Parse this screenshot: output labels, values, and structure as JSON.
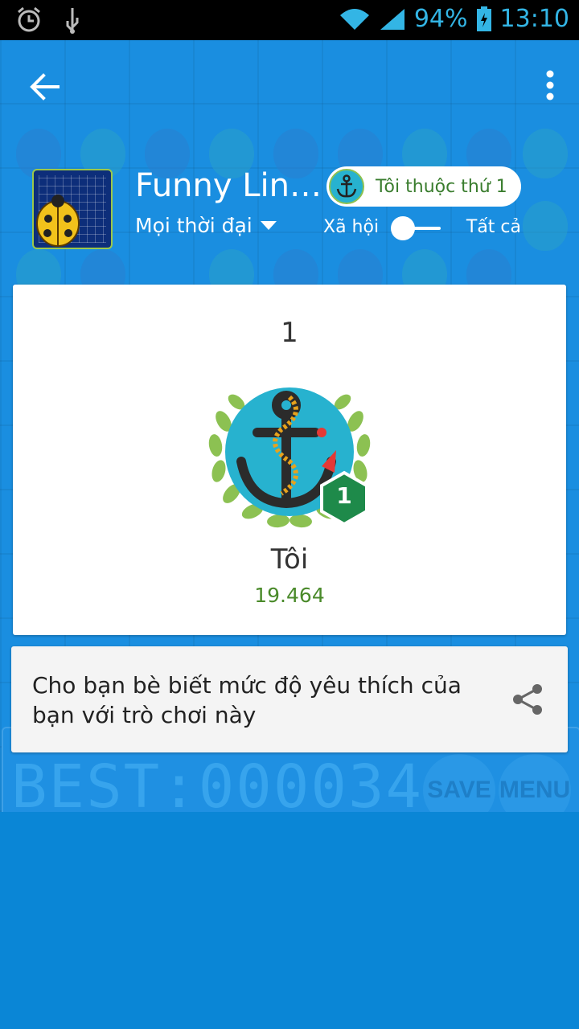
{
  "status_bar": {
    "battery_percent": "94%",
    "time": "13:10",
    "icons": [
      "alarm-icon",
      "usb-icon",
      "wifi-icon",
      "signal-icon",
      "battery-icon"
    ]
  },
  "toolbar": {
    "back_icon": "arrow-left-icon",
    "overflow_icon": "more-vert-icon"
  },
  "game": {
    "title": "Funny Lin…",
    "period_selector": "Mọi thời đại",
    "rank_pill_label": "Tôi thuộc thứ 1",
    "toggle_left_label": "Xã hội",
    "toggle_right_label": "Tất cả"
  },
  "leaderboard_card": {
    "rank": "1",
    "badge_rank": "1",
    "player_name": "Tôi",
    "score": "19.464"
  },
  "share_card": {
    "text": "Cho bạn bè biết mức độ yêu thích của bạn với trò chơi này",
    "icon": "share-icon"
  },
  "background_game": {
    "score_digits": "BEST:000034",
    "save_label": "SAVE",
    "menu_label": "MENU"
  },
  "colors": {
    "background": "#0a86d6",
    "card": "#ffffff",
    "score_green": "#4a8a2a",
    "badge_teal": "#27b2cf",
    "badge_hex_green": "#1e8a4a"
  }
}
